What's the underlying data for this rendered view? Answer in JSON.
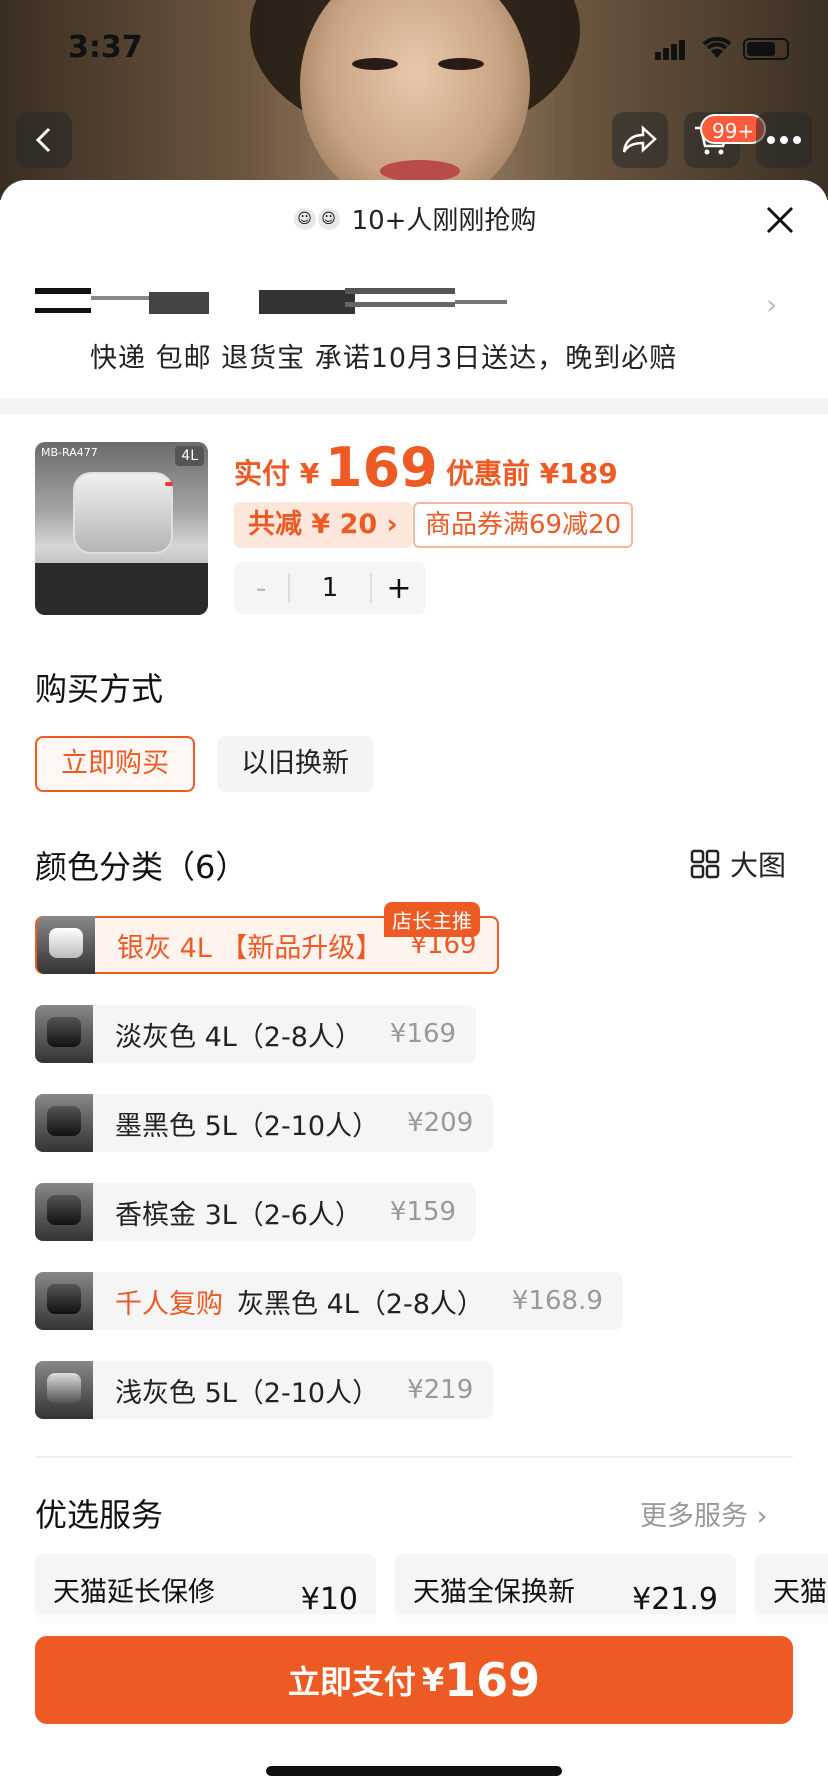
{
  "status_bar": {
    "time": "3:37"
  },
  "nav": {
    "cart_badge": "99+"
  },
  "sheet": {
    "recent_buyers": "10+人刚刚抢购",
    "delivery_info": "快递 包邮 退货宝 承诺10月3日送达，晚到必赔"
  },
  "product": {
    "pay_label": "实付 ¥",
    "pay_amount": "169",
    "before_discount": "优惠前 ¥189",
    "total_saving": "共减 ¥ 20 ›",
    "coupon": "商品券满69减20",
    "quantity": "1",
    "qty_minus": "-",
    "qty_plus": "+",
    "image_tag": "4L",
    "image_model": "MB-RA477"
  },
  "purchase_method": {
    "title": "购买方式",
    "options": [
      {
        "label": "立即购买",
        "selected": true
      },
      {
        "label": "以旧换新",
        "selected": false
      }
    ]
  },
  "variants": {
    "title": "颜色分类（6）",
    "big_view": "大图",
    "shop_pick": "店长主推",
    "items": [
      {
        "name": "银灰 4L 【新品升级】",
        "price": "¥169",
        "hot": "",
        "selected": true
      },
      {
        "name": "淡灰色 4L（2-8人）",
        "price": "¥169",
        "hot": "",
        "selected": false
      },
      {
        "name": "墨黑色 5L（2-10人）",
        "price": "¥209",
        "hot": "",
        "selected": false
      },
      {
        "name": "香槟金 3L（2-6人）",
        "price": "¥159",
        "hot": "",
        "selected": false
      },
      {
        "name": "灰黑色 4L（2-8人）",
        "price": "¥168.9",
        "hot": "千人复购",
        "selected": false
      },
      {
        "name": "浅灰色 5L（2-10人）",
        "price": "¥219",
        "hot": "",
        "selected": false
      }
    ]
  },
  "services": {
    "title": "优选服务",
    "more": "更多服务 ›",
    "items": [
      {
        "name": "天猫延长保修",
        "price": "¥10"
      },
      {
        "name": "天猫全保换新",
        "price": "¥21.9"
      },
      {
        "name": "天猫",
        "price": ""
      }
    ]
  },
  "pay_button": {
    "label": "立即支付",
    "currency": "¥",
    "amount": "169"
  },
  "colors": {
    "accent": "#ee5a24",
    "accent_light": "#fde7dd"
  }
}
